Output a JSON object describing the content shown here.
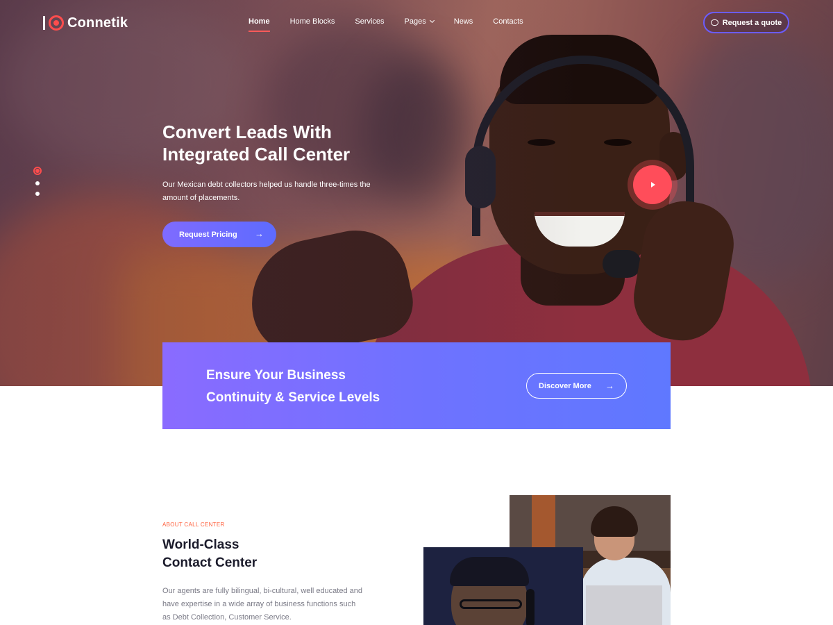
{
  "header": {
    "logo_text": "Connetik",
    "nav": [
      {
        "label": "Home",
        "active": true
      },
      {
        "label": "Home Blocks",
        "active": false
      },
      {
        "label": "Services",
        "active": false
      },
      {
        "label": "Pages",
        "active": false,
        "has_dropdown": true
      },
      {
        "label": "News",
        "active": false
      },
      {
        "label": "Contacts",
        "active": false
      }
    ],
    "cta_label": "Request a quote",
    "cta_icon": "chat-bubble-icon"
  },
  "hero": {
    "title_line1": "Convert Leads With",
    "title_line2": "Integrated Call Center",
    "subtitle": "Our Mexican debt collectors helped us handle three-times the amount of placements.",
    "button_label": "Request Pricing",
    "button_arrow": "→",
    "slider_dots": 3,
    "active_slide": 1,
    "play_icon": "play-icon"
  },
  "banner": {
    "title_line1": "Ensure Your Business",
    "title_line2": "Continuity & Service Levels",
    "button_label": "Discover More",
    "button_arrow": "→"
  },
  "about": {
    "eyebrow": "ABOUT CALL CENTER",
    "title_line1": "World-Class",
    "title_line2": "Contact Center",
    "text": "Our agents are fully bilingual, bi-cultural, well educated and have expertise in a wide array of business functions such as Debt Collection, Customer Service."
  },
  "colors": {
    "accent_red": "#ff4d5a",
    "accent_purple": "#6b5cff",
    "eyebrow_orange": "#ff5e3a"
  }
}
